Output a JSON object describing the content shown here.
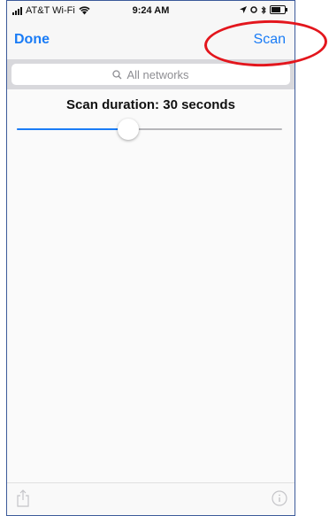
{
  "status_bar": {
    "carrier": "AT&T Wi-Fi",
    "time": "9:24 AM"
  },
  "nav": {
    "done_label": "Done",
    "scan_label": "Scan"
  },
  "search": {
    "placeholder": "All networks"
  },
  "scan": {
    "duration_label": "Scan duration: 30 seconds",
    "slider_value_fraction": 0.42
  },
  "colors": {
    "accent": "#1a7cf6",
    "annotation": "#e3161d"
  },
  "icons": {
    "share": "share-icon",
    "info": "info-icon",
    "search": "search-icon"
  }
}
